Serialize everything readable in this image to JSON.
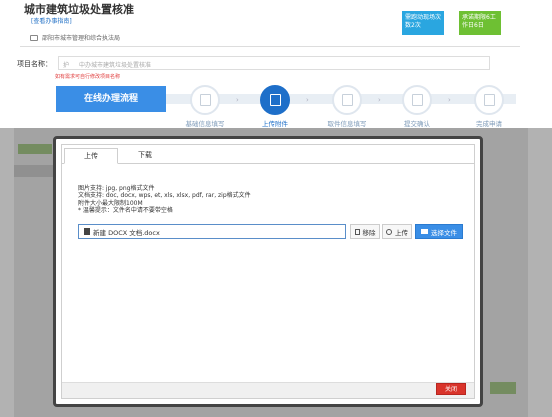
{
  "header": {
    "title": "城市建筑垃圾处置核准",
    "guide_link": "[查看办事指南]",
    "org": "邵阳市城市管理和综合执法局",
    "badge_left": "需跑动现场次数2次",
    "badge_right": "承诺期限6工作日6日"
  },
  "project": {
    "label": "项目名称：",
    "placeholder": "中办城市建筑垃圾处置核准",
    "prefix": "护",
    "hint": "如有需求可自行修改项目名称"
  },
  "flow": {
    "title": "在线办理流程",
    "steps": [
      {
        "label": "基础信息填写",
        "state": "done"
      },
      {
        "label": "上传附件",
        "state": "active"
      },
      {
        "label": "取件信息填写",
        "state": "todo"
      },
      {
        "label": "提交确认",
        "state": "todo"
      },
      {
        "label": "完成申请",
        "state": "todo"
      }
    ]
  },
  "modal": {
    "tabs": [
      "上传",
      "下载"
    ],
    "info_lines": [
      "图片支持: jpg, png格式文件",
      "文档支持: doc, docx, wps, et, xls, xlsx, pdf, rar, zip格式文件",
      "附件大小最大限制100M",
      "* 温馨提示：文件名中请不要带空格"
    ],
    "file_name": "新建 DOCX 文档.docx",
    "btn_remove": "移除",
    "btn_upload": "上传",
    "btn_choose": "选择文件",
    "btn_close": "关闭"
  },
  "colors": {
    "accent": "#1e6fc9",
    "badge_blue": "#2aa6e0",
    "badge_green": "#6ec033",
    "close_red": "#d9342b",
    "warning_red": "#e03c3c"
  }
}
